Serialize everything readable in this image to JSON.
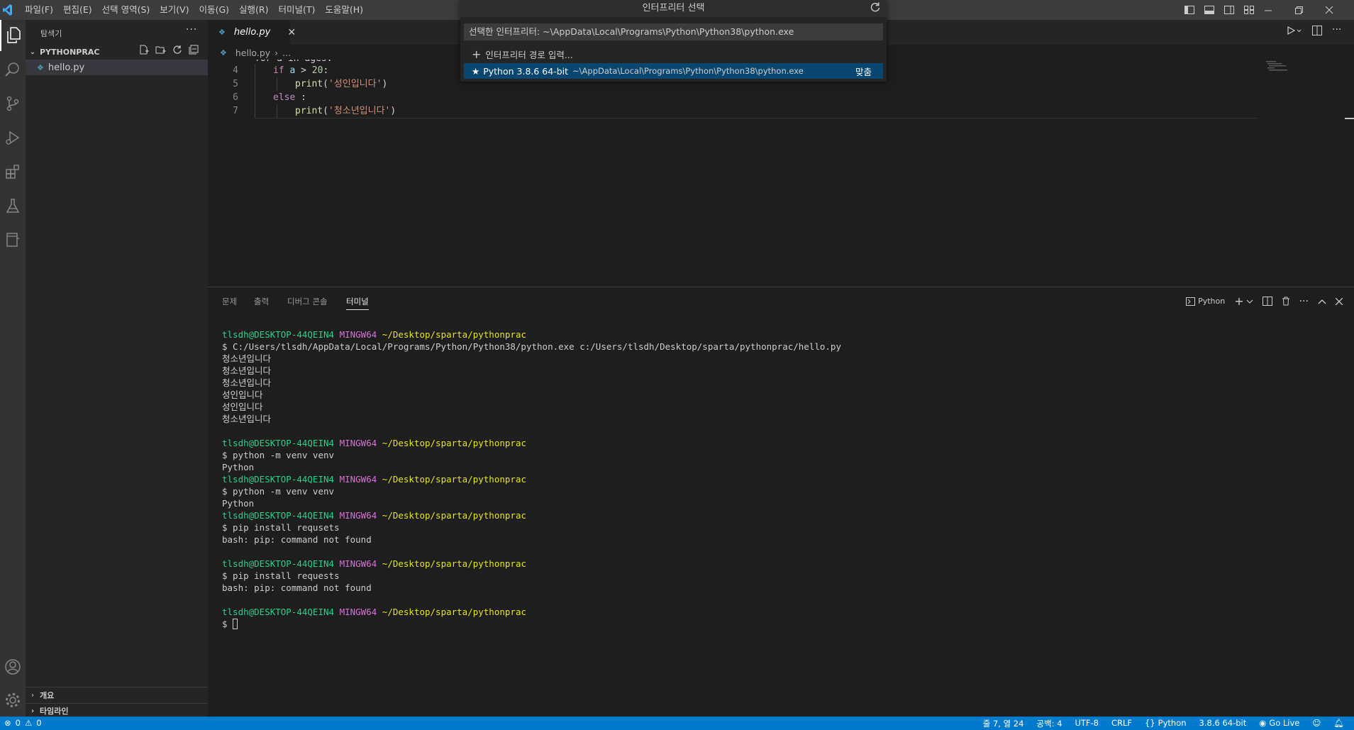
{
  "menu": [
    "파일(F)",
    "편집(E)",
    "선택 영역(S)",
    "보기(V)",
    "이동(G)",
    "실행(R)",
    "터미널(T)",
    "도움말(H)"
  ],
  "sidebar": {
    "title": "탐색기",
    "folder": "PYTHONPRAC",
    "file": "hello.py",
    "outline": "개요",
    "timeline": "타임라인"
  },
  "editor": {
    "tab": "hello.py",
    "breadcrumb_file": "hello.py",
    "breadcrumb_rest": "...",
    "lines": [
      {
        "num": "4",
        "indent": 1,
        "tokens": [
          {
            "t": "if",
            "c": "kw"
          },
          {
            "t": " a ",
            "c": "var"
          },
          {
            "t": "> ",
            "c": ""
          },
          {
            "t": "20",
            "c": "num"
          },
          {
            "t": ":",
            "c": ""
          }
        ]
      },
      {
        "num": "5",
        "indent": 2,
        "tokens": [
          {
            "t": "print",
            "c": "fn"
          },
          {
            "t": "(",
            "c": ""
          },
          {
            "t": "'성인입니다'",
            "c": "str"
          },
          {
            "t": ")",
            "c": ""
          }
        ]
      },
      {
        "num": "6",
        "indent": 1,
        "tokens": [
          {
            "t": "else",
            "c": "kw"
          },
          {
            "t": " :",
            "c": ""
          }
        ]
      },
      {
        "num": "7",
        "indent": 2,
        "tokens": [
          {
            "t": "print",
            "c": "fn"
          },
          {
            "t": "(",
            "c": ""
          },
          {
            "t": "'청소년입니다'",
            "c": "str"
          },
          {
            "t": ")",
            "c": ""
          }
        ]
      }
    ]
  },
  "quickpick": {
    "title": "인터프리터 선택",
    "input_value": "선택한 인터프리터: ~\\AppData\\Local\\Programs\\Python\\Python38\\python.exe",
    "enter_path": "인터프리터 경로 입력...",
    "python_label": "Python 3.8.6 64-bit",
    "python_path": "~\\AppData\\Local\\Programs\\Python\\Python38\\python.exe",
    "badge": "맞춤"
  },
  "panel": {
    "tabs": [
      "문제",
      "출력",
      "디버그 콘솔",
      "터미널"
    ],
    "active_tab": "터미널",
    "terminal_kind": "Python",
    "terminal": [
      {
        "type": "prompt",
        "user": "tlsdh@DESKTOP-44QEIN4",
        "host": "MINGW64",
        "path": "~/Desktop/sparta/pythonprac"
      },
      {
        "type": "text",
        "text": "$ C:/Users/tlsdh/AppData/Local/Programs/Python/Python38/python.exe c:/Users/tlsdh/Desktop/sparta/pythonprac/hello.py"
      },
      {
        "type": "text",
        "text": "청소년입니다"
      },
      {
        "type": "text",
        "text": "청소년입니다"
      },
      {
        "type": "text",
        "text": "청소년입니다"
      },
      {
        "type": "text",
        "text": "성인입니다"
      },
      {
        "type": "text",
        "text": "성인입니다"
      },
      {
        "type": "text",
        "text": "청소년입니다"
      },
      {
        "type": "text",
        "text": ""
      },
      {
        "type": "prompt",
        "user": "tlsdh@DESKTOP-44QEIN4",
        "host": "MINGW64",
        "path": "~/Desktop/sparta/pythonprac"
      },
      {
        "type": "text",
        "text": "$ python -m venv venv"
      },
      {
        "type": "text",
        "text": "Python"
      },
      {
        "type": "prompt",
        "user": "tlsdh@DESKTOP-44QEIN4",
        "host": "MINGW64",
        "path": "~/Desktop/sparta/pythonprac"
      },
      {
        "type": "text",
        "text": "$ python -m venv venv"
      },
      {
        "type": "text",
        "text": "Python"
      },
      {
        "type": "prompt",
        "user": "tlsdh@DESKTOP-44QEIN4",
        "host": "MINGW64",
        "path": "~/Desktop/sparta/pythonprac"
      },
      {
        "type": "text",
        "text": "$ pip install requsets"
      },
      {
        "type": "text",
        "text": "bash: pip: command not found"
      },
      {
        "type": "text",
        "text": ""
      },
      {
        "type": "prompt",
        "user": "tlsdh@DESKTOP-44QEIN4",
        "host": "MINGW64",
        "path": "~/Desktop/sparta/pythonprac"
      },
      {
        "type": "text",
        "text": "$ pip install requests"
      },
      {
        "type": "text",
        "text": "bash: pip: command not found"
      },
      {
        "type": "text",
        "text": ""
      },
      {
        "type": "prompt",
        "user": "tlsdh@DESKTOP-44QEIN4",
        "host": "MINGW64",
        "path": "~/Desktop/sparta/pythonprac"
      },
      {
        "type": "cursor",
        "text": "$ "
      }
    ]
  },
  "statusbar": {
    "errors": "0",
    "warnings": "0",
    "position": "줄 7, 열 24",
    "spaces": "공백: 4",
    "encoding": "UTF-8",
    "eol": "CRLF",
    "language": "Python",
    "interpreter": "3.8.6 64-bit",
    "golive": "Go Live"
  },
  "colors": {
    "accent": "#007acc",
    "selection": "#094771",
    "terminal_user": "#23d18b",
    "terminal_host": "#d670d6",
    "terminal_path": "#e5e510"
  }
}
